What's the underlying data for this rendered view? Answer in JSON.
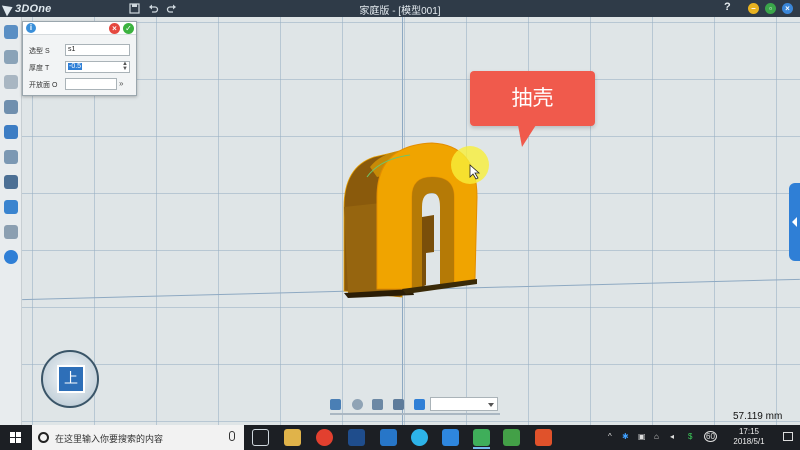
{
  "app": {
    "logo_text": "3DOne",
    "window_title": "家庭版 - [模型001]",
    "help_label": "?"
  },
  "shell_dialog": {
    "rows": [
      {
        "label": "选型 S",
        "value": "s1"
      },
      {
        "label": "厚度 T",
        "value": "-0.5"
      },
      {
        "label": "开放面 O",
        "value": ""
      }
    ]
  },
  "callout": {
    "text": "抽壳",
    "color": "#f05a4c"
  },
  "viewcube": {
    "face_label": "上"
  },
  "status": {
    "measurement": "57.119 mm"
  },
  "taskbar": {
    "search_placeholder": "在这里输入你要搜索的内容",
    "clock_time": "17:15",
    "clock_date": "2018/5/1",
    "badge": "60"
  },
  "colors": {
    "accent": "#2f7fd6",
    "model": "#f0a400",
    "titlebar": "#2f3b48"
  }
}
